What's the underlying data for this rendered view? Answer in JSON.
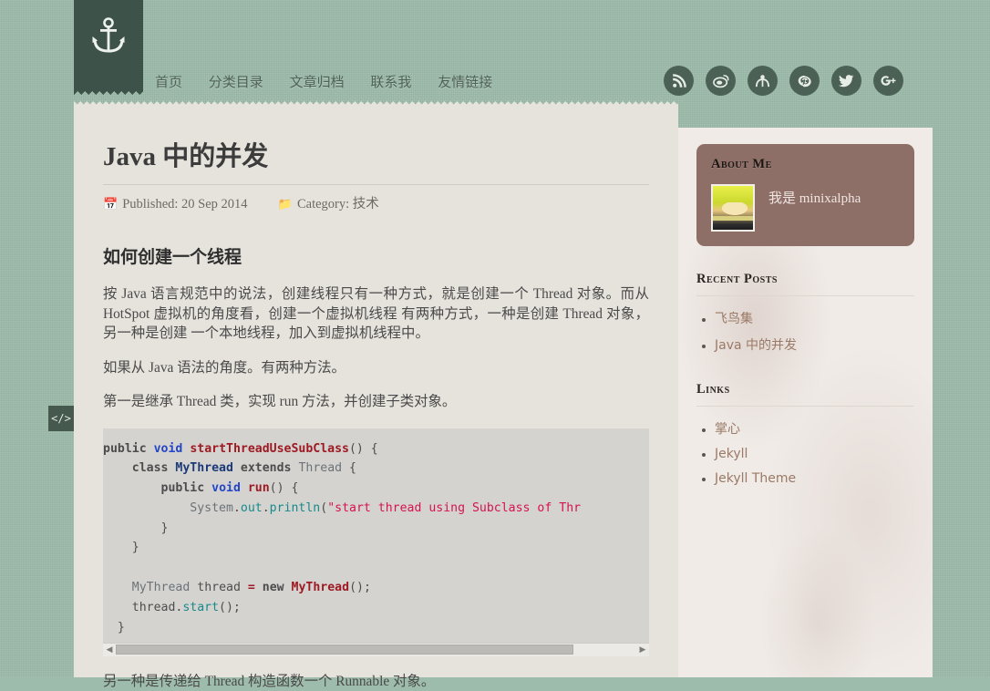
{
  "site": {
    "logo_icon": "anchor-icon",
    "nav": [
      {
        "label": "首页"
      },
      {
        "label": "分类目录"
      },
      {
        "label": "文章归档"
      },
      {
        "label": "联系我"
      },
      {
        "label": "友情链接"
      }
    ],
    "social": [
      {
        "name": "rss-icon",
        "glyph": "•"
      },
      {
        "name": "weibo-icon",
        "glyph": "•"
      },
      {
        "name": "tencent-weibo-icon",
        "glyph": "•"
      },
      {
        "name": "github-icon",
        "glyph": "•"
      },
      {
        "name": "twitter-icon",
        "glyph": "•"
      },
      {
        "name": "google-plus-icon",
        "glyph": "g+"
      }
    ]
  },
  "post": {
    "title": "Java 中的并发",
    "published_icon": "calendar-icon",
    "published_label": "Published:",
    "published_date": "20 Sep 2014",
    "category_icon": "folder-icon",
    "category_label": "Category:",
    "category_value": "技术",
    "section_heading": "如何创建一个线程",
    "paragraph_1": "按 Java 语言规范中的说法，创建线程只有一种方式，就是创建一个 Thread 对象。而从 HotSpot 虚拟机的角度看，创建一个虚拟机线程 有两种方式，一种是创建 Thread 对象，另一种是创建 一个本地线程，加入到虚拟机线程中。",
    "paragraph_2": "如果从 Java 语法的角度。有两种方法。",
    "paragraph_3": "第一是继承 Thread 类，实现 run 方法，并创建子类对象。",
    "paragraph_4": "另一种是传递给 Thread 构造函数一个 Runnable 对象。",
    "code_toggle_label": "</>",
    "code_language": "java",
    "code_lines": [
      "public void startThreadUseSubClass() {",
      "    class MyThread extends Thread {",
      "        public void run() {",
      "            System.out.println(\"start thread using Subclass of Thr",
      "        }",
      "    }",
      "",
      "    MyThread thread = new MyThread();",
      "    thread.start();",
      "}"
    ],
    "scrollbar": {
      "left_arrow": "◀",
      "right_arrow": "▶",
      "thumb_percent": 88
    }
  },
  "sidebar": {
    "about": {
      "heading": "About Me",
      "avatar_name": "avatar",
      "text": "我是 minixalpha"
    },
    "recent": {
      "heading": "Recent Posts",
      "items": [
        {
          "label": "飞鸟集"
        },
        {
          "label": "Java 中的并发"
        }
      ]
    },
    "links": {
      "heading": "Links",
      "items": [
        {
          "label": "掌心"
        },
        {
          "label": "Jekyll"
        },
        {
          "label": "Jekyll Theme"
        }
      ]
    }
  },
  "colors": {
    "page_bg": "#9dbcab",
    "banner": "#3d5249",
    "panel_bg": "#e6e2dc",
    "sidebar_bg": "#f0ebe7",
    "about_card": "#8e6f67",
    "link": "#9a7a66",
    "code_bg": "#d4d3d0"
  }
}
